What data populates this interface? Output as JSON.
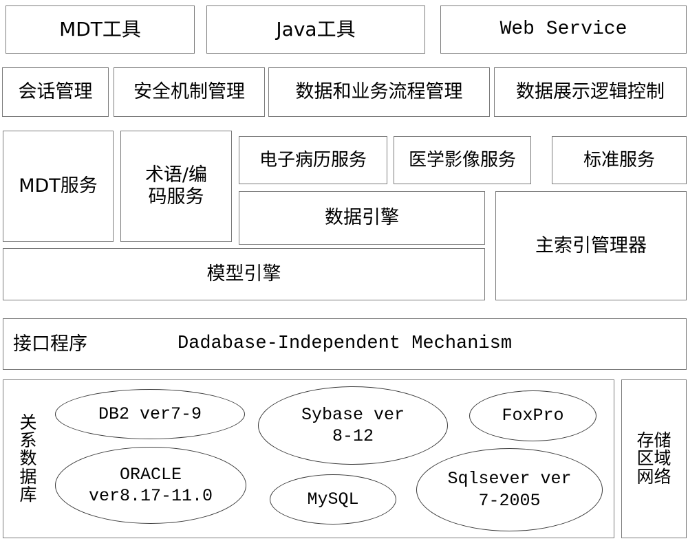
{
  "diagram": {
    "title": "Medical information platform layered architecture",
    "colors": {
      "box_border": "#7a7a7a",
      "ellipse_border": "#3a3a3a",
      "background": "#ffffff",
      "text": "#000000"
    }
  },
  "layer_tools": {
    "boxes": [
      {
        "label": "MDT工具"
      },
      {
        "label": "Java工具"
      },
      {
        "label": "Web Service"
      }
    ]
  },
  "layer_management": {
    "boxes": [
      {
        "label": "会话管理"
      },
      {
        "label": "安全机制管理"
      },
      {
        "label": "数据和业务流程管理"
      },
      {
        "label": "数据展示逻辑控制"
      }
    ]
  },
  "layer_services": {
    "mdt_service": "MDT服务",
    "terminology_service": "术语/编\n码服务",
    "emr_service": "电子病历服务",
    "imaging_service": "医学影像服务",
    "standard_service": "标准服务",
    "data_engine": "数据引擎",
    "model_engine": "模型引擎",
    "master_index_manager": "主索引管理器"
  },
  "layer_interface": {
    "label": "接口程序",
    "title": "Dadabase-Independent Mechanism"
  },
  "layer_storage": {
    "relational_db_label": [
      "关",
      "系",
      "数",
      "据",
      "库"
    ],
    "san_label": [
      "存储",
      "区域",
      "网络"
    ],
    "databases": [
      {
        "name": "DB2 ver7-9"
      },
      {
        "name": "ORACLE\nver8.17-11.0"
      },
      {
        "name": "Sybase ver\n8-12"
      },
      {
        "name": "MySQL"
      },
      {
        "name": "FoxPro"
      },
      {
        "name": "Sqlsever ver\n7-2005"
      }
    ]
  }
}
